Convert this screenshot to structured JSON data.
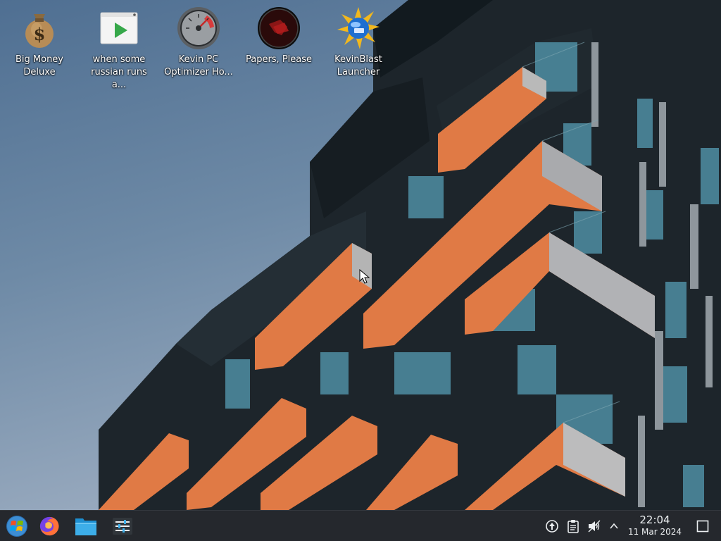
{
  "desktop": {
    "icons": [
      {
        "label": "Big Money Deluxe",
        "icon": "money-bag-icon"
      },
      {
        "label": "when some russian runs a...",
        "icon": "video-player-icon"
      },
      {
        "label": "Kevin PC Optimizer Ho...",
        "icon": "speedometer-icon"
      },
      {
        "label": "Papers, Please",
        "icon": "papers-please-icon"
      },
      {
        "label": "KevinBlast Launcher",
        "icon": "kevinblast-icon"
      }
    ]
  },
  "taskbar": {
    "launcher": {
      "icon": "start-menu-icon"
    },
    "pinned": [
      {
        "icon": "firefox-icon"
      },
      {
        "icon": "file-manager-icon"
      },
      {
        "icon": "system-settings-icon"
      }
    ],
    "tray": [
      {
        "icon": "update-notifier-icon"
      },
      {
        "icon": "clipboard-icon"
      },
      {
        "icon": "volume-muted-icon"
      },
      {
        "icon": "tray-expand-icon"
      }
    ],
    "clock": {
      "time": "22:04",
      "date": "11 Mar 2024"
    }
  },
  "colors": {
    "taskbar": "#25282d",
    "balcony": "#e07a45",
    "building": "#1f272d"
  }
}
